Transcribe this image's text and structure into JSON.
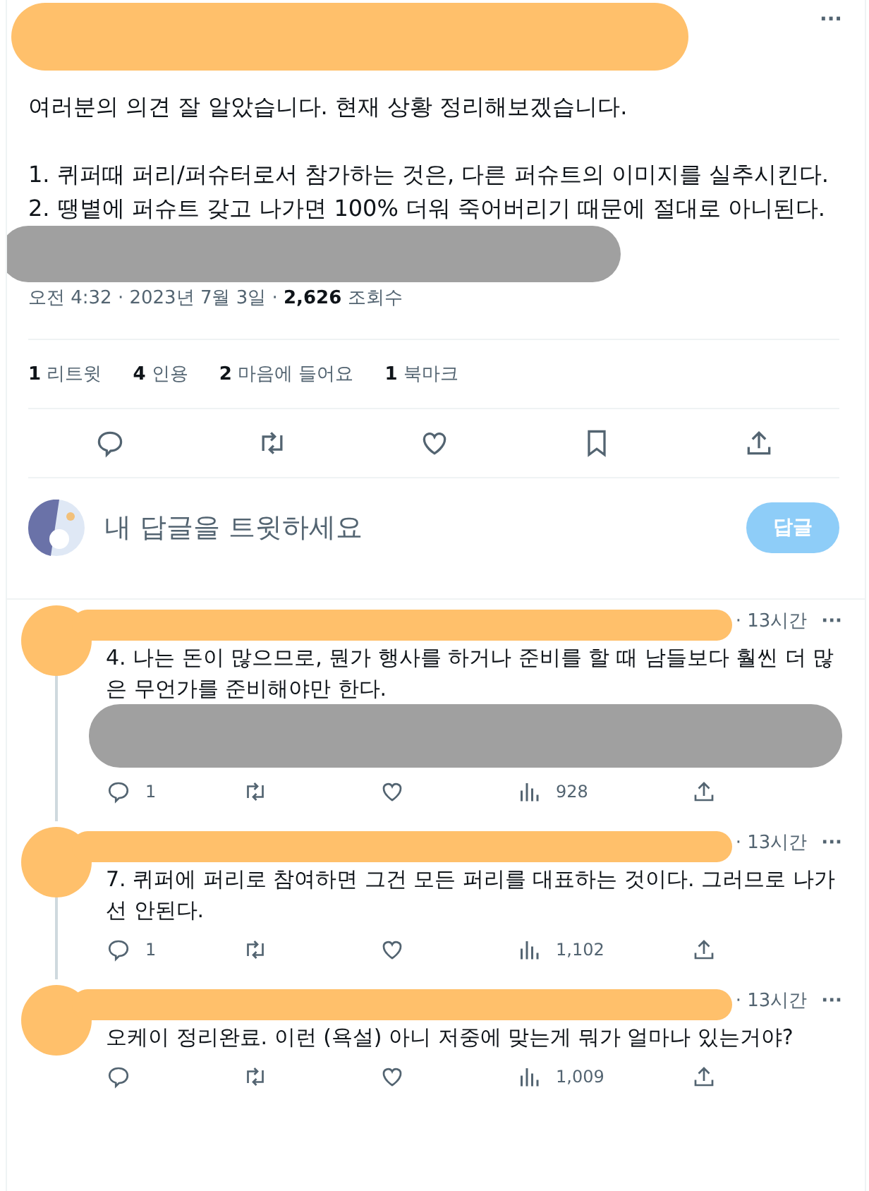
{
  "tweet": {
    "author_redacted": true,
    "menu": "···",
    "paragraphs": [
      "여러분의 의견 잘 알았습니다. 현재 상황 정리해보겠습니다.",
      "1. 퀴퍼때 퍼리/퍼슈터로서 참가하는 것은, 다른 퍼슈트의 이미지를 실추시킨다.\n2. 땡볕에 퍼슈트 갖고 나가면 100% 더워 죽어버리기 때문에 절대로 아니된다."
    ],
    "trailing_redacted": true,
    "meta": {
      "time": "오전 4:32 · 2023년 7월 3일 · ",
      "views_count": "2,626",
      "views_label": " 조회수"
    },
    "stats": [
      {
        "count": "1",
        "label": "리트윗"
      },
      {
        "count": "4",
        "label": "인용"
      },
      {
        "count": "2",
        "label": "마음에 들어요"
      },
      {
        "count": "1",
        "label": "북마크"
      }
    ],
    "actions": [
      {
        "kind": "reply"
      },
      {
        "kind": "retweet"
      },
      {
        "kind": "like"
      },
      {
        "kind": "bookmark"
      },
      {
        "kind": "share"
      }
    ]
  },
  "compose": {
    "placeholder": "내 답글을 트윗하세요",
    "button": "답글",
    "button_disabled": true
  },
  "replies": [
    {
      "time": "· 13시간",
      "menu": "···",
      "text": "4. 나는 돈이 많으므로, 뭔가 행사를 하거나 준비를 할 때 남들보다 훨씬 더 많은 무언가를 준비해야만 한다.",
      "media_redacted": true,
      "thread": true,
      "actions": [
        {
          "kind": "reply",
          "count": "1"
        },
        {
          "kind": "retweet"
        },
        {
          "kind": "like"
        },
        {
          "kind": "views",
          "count": "928"
        },
        {
          "kind": "share"
        }
      ]
    },
    {
      "time": "· 13시간",
      "menu": "···",
      "text": "7. 퀴퍼에 퍼리로 참여하면 그건 모든 퍼리를 대표하는 것이다. 그러므로 나가선 안된다.",
      "media_redacted": false,
      "thread": true,
      "actions": [
        {
          "kind": "reply",
          "count": "1"
        },
        {
          "kind": "retweet"
        },
        {
          "kind": "like"
        },
        {
          "kind": "views",
          "count": "1,102"
        },
        {
          "kind": "share"
        }
      ]
    },
    {
      "time": "· 13시간",
      "menu": "···",
      "text": "오케이 정리완료. 이런 (욕설) 아니 저중에 맞는게 뭐가 얼마나 있는거야?",
      "media_redacted": false,
      "thread": false,
      "actions": [
        {
          "kind": "reply"
        },
        {
          "kind": "retweet"
        },
        {
          "kind": "like"
        },
        {
          "kind": "views",
          "count": "1,009"
        },
        {
          "kind": "share"
        }
      ]
    }
  ]
}
